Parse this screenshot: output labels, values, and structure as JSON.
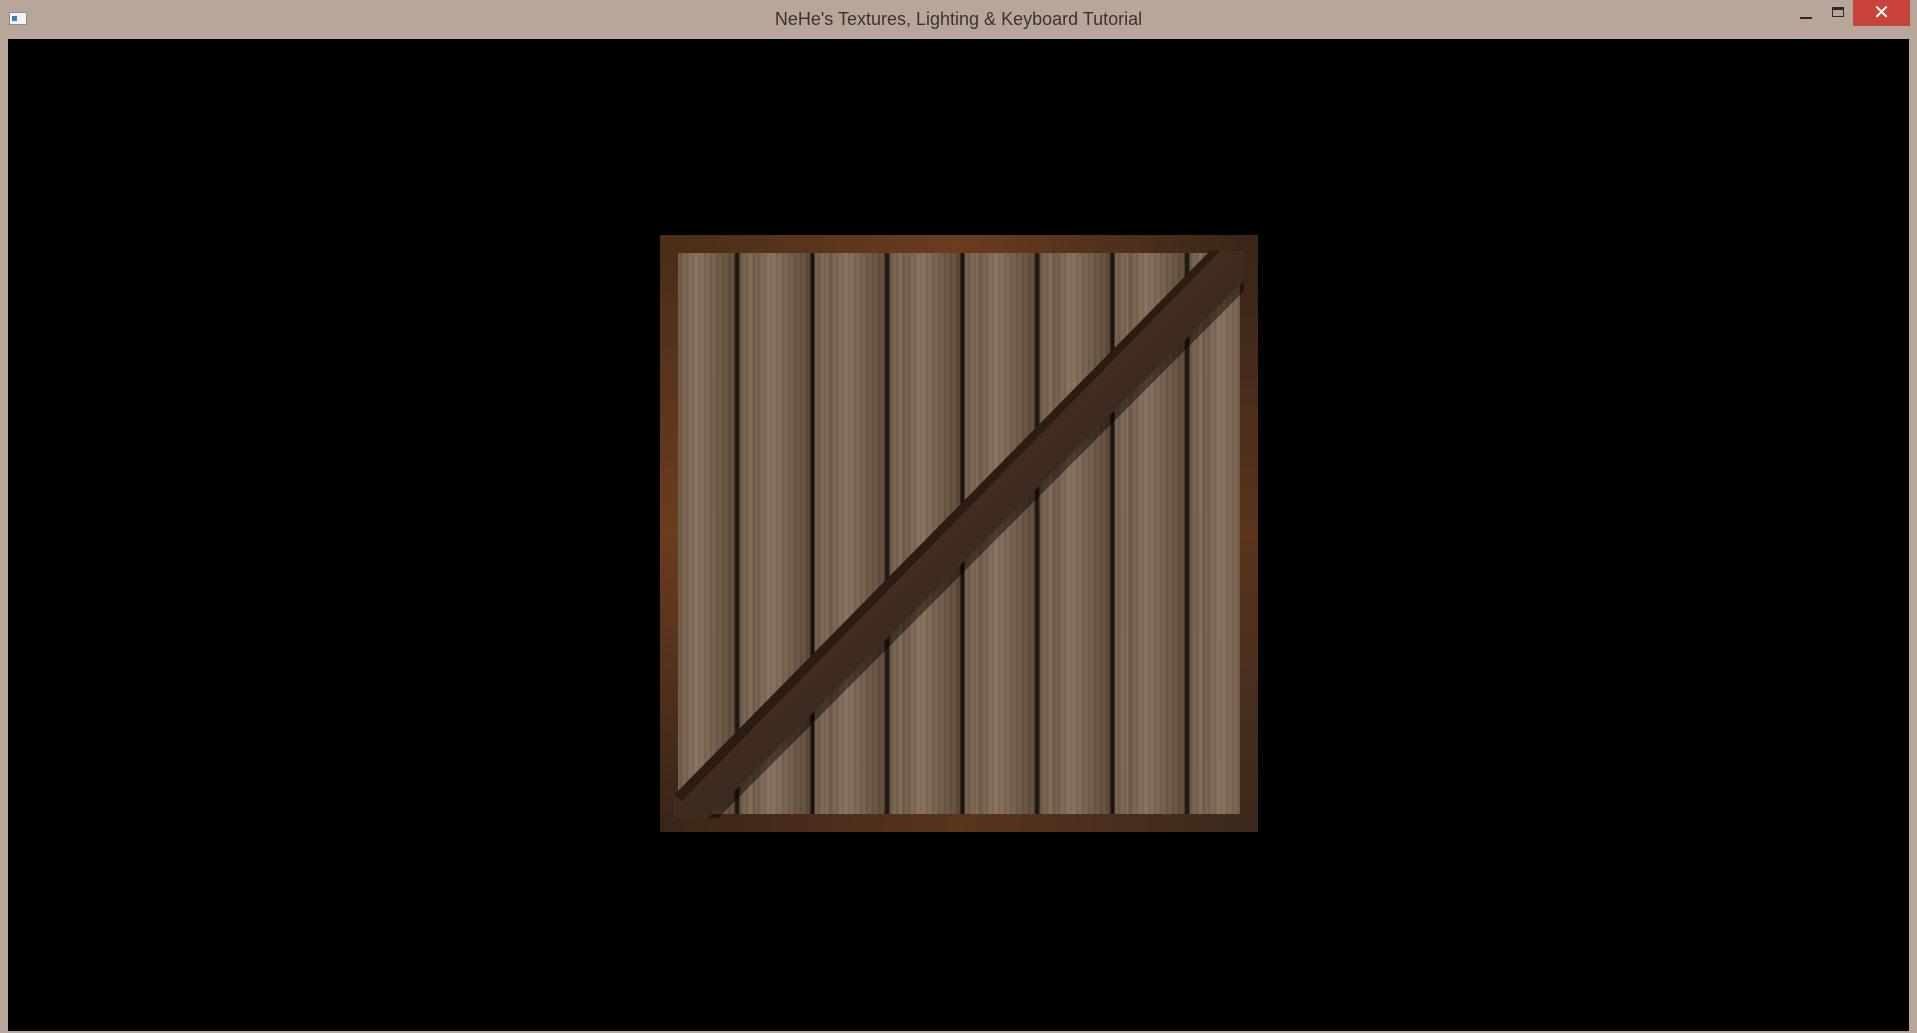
{
  "window": {
    "title": "NeHe's Textures, Lighting & Keyboard Tutorial",
    "controls": {
      "minimize": "minimize",
      "maximize": "maximize",
      "close": "✕"
    }
  },
  "scene": {
    "background": "#000000",
    "object": "wooden crate"
  },
  "colors": {
    "titlebar": "#b7a699",
    "close_button": "#c7433b",
    "wood": "#7a6551",
    "rust": "#5a341b"
  }
}
